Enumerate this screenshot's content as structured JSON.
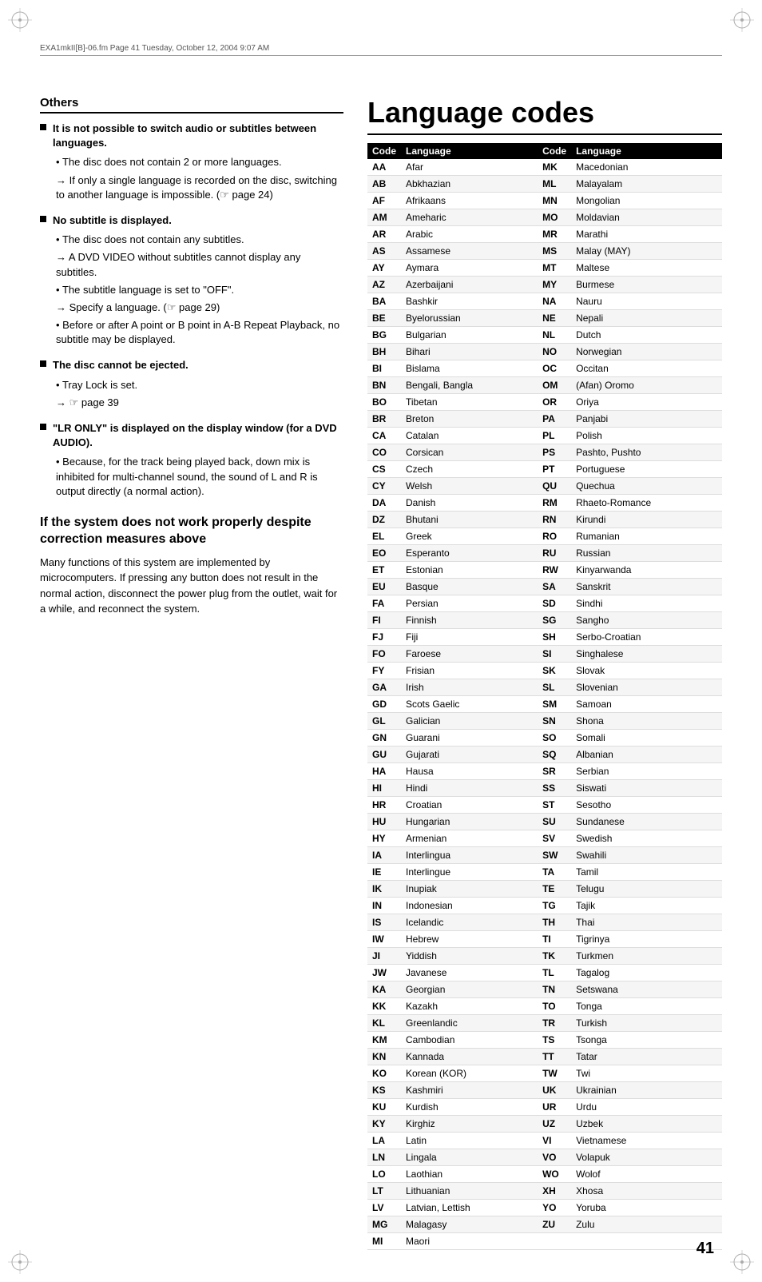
{
  "header": {
    "text": "EXA1mkII[B]-06.fm  Page 41  Tuesday, October 12, 2004  9:07 AM"
  },
  "page_title": "Language codes",
  "left": {
    "section_heading": "Others",
    "blocks": [
      {
        "id": "block1",
        "heading": "It is not possible to switch audio or subtitles between languages.",
        "sub_items": [
          {
            "type": "bullet",
            "text": "The disc does not contain 2 or more languages."
          },
          {
            "type": "arrow",
            "text": "If only a single language is recorded on the disc, switching to another language is impossible. (☞ page 24)"
          }
        ]
      },
      {
        "id": "block2",
        "heading": "No subtitle is displayed.",
        "sub_items": [
          {
            "type": "bullet",
            "text": "The disc does not contain any subtitles."
          },
          {
            "type": "arrow",
            "text": "A DVD VIDEO without subtitles cannot display any subtitles."
          },
          {
            "type": "bullet",
            "text": "The subtitle language is set to \"OFF\"."
          },
          {
            "type": "arrow",
            "text": "Specify a language. (☞ page 29)"
          },
          {
            "type": "bullet",
            "text": "Before or after A point or B point in A-B Repeat Playback, no subtitle may be displayed."
          }
        ]
      },
      {
        "id": "block3",
        "heading": "The disc cannot be ejected.",
        "sub_items": [
          {
            "type": "bullet",
            "text": "Tray Lock is set."
          },
          {
            "type": "arrow",
            "text": "☞ page 39"
          }
        ]
      },
      {
        "id": "block4",
        "heading": "\"LR ONLY\" is displayed on the display window (for a DVD AUDIO).",
        "sub_items": [
          {
            "type": "bullet",
            "text": "Because, for the track being played back, down mix is inhibited for multi-channel sound, the sound of L and R is output directly (a normal action)."
          }
        ]
      }
    ],
    "system_section": {
      "title": "If the system does not work properly despite correction measures above",
      "body": "Many functions of this system are implemented by microcomputers. If pressing any button does not result in the normal action, disconnect the power plug from the outlet, wait for a while, and reconnect the system."
    }
  },
  "table": {
    "headers": [
      "Code",
      "Language",
      "Code",
      "Language"
    ],
    "rows": [
      [
        "AA",
        "Afar",
        "MK",
        "Macedonian"
      ],
      [
        "AB",
        "Abkhazian",
        "ML",
        "Malayalam"
      ],
      [
        "AF",
        "Afrikaans",
        "MN",
        "Mongolian"
      ],
      [
        "AM",
        "Ameharic",
        "MO",
        "Moldavian"
      ],
      [
        "AR",
        "Arabic",
        "MR",
        "Marathi"
      ],
      [
        "AS",
        "Assamese",
        "MS",
        "Malay (MAY)"
      ],
      [
        "AY",
        "Aymara",
        "MT",
        "Maltese"
      ],
      [
        "AZ",
        "Azerbaijani",
        "MY",
        "Burmese"
      ],
      [
        "BA",
        "Bashkir",
        "NA",
        "Nauru"
      ],
      [
        "BE",
        "Byelorussian",
        "NE",
        "Nepali"
      ],
      [
        "BG",
        "Bulgarian",
        "NL",
        "Dutch"
      ],
      [
        "BH",
        "Bihari",
        "NO",
        "Norwegian"
      ],
      [
        "BI",
        "Bislama",
        "OC",
        "Occitan"
      ],
      [
        "BN",
        "Bengali, Bangla",
        "OM",
        "(Afan) Oromo"
      ],
      [
        "BO",
        "Tibetan",
        "OR",
        "Oriya"
      ],
      [
        "BR",
        "Breton",
        "PA",
        "Panjabi"
      ],
      [
        "CA",
        "Catalan",
        "PL",
        "Polish"
      ],
      [
        "CO",
        "Corsican",
        "PS",
        "Pashto, Pushto"
      ],
      [
        "CS",
        "Czech",
        "PT",
        "Portuguese"
      ],
      [
        "CY",
        "Welsh",
        "QU",
        "Quechua"
      ],
      [
        "DA",
        "Danish",
        "RM",
        "Rhaeto-Romance"
      ],
      [
        "DZ",
        "Bhutani",
        "RN",
        "Kirundi"
      ],
      [
        "EL",
        "Greek",
        "RO",
        "Rumanian"
      ],
      [
        "EO",
        "Esperanto",
        "RU",
        "Russian"
      ],
      [
        "ET",
        "Estonian",
        "RW",
        "Kinyarwanda"
      ],
      [
        "EU",
        "Basque",
        "SA",
        "Sanskrit"
      ],
      [
        "FA",
        "Persian",
        "SD",
        "Sindhi"
      ],
      [
        "FI",
        "Finnish",
        "SG",
        "Sangho"
      ],
      [
        "FJ",
        "Fiji",
        "SH",
        "Serbo-Croatian"
      ],
      [
        "FO",
        "Faroese",
        "SI",
        "Singhalese"
      ],
      [
        "FY",
        "Frisian",
        "SK",
        "Slovak"
      ],
      [
        "GA",
        "Irish",
        "SL",
        "Slovenian"
      ],
      [
        "GD",
        "Scots Gaelic",
        "SM",
        "Samoan"
      ],
      [
        "GL",
        "Galician",
        "SN",
        "Shona"
      ],
      [
        "GN",
        "Guarani",
        "SO",
        "Somali"
      ],
      [
        "GU",
        "Gujarati",
        "SQ",
        "Albanian"
      ],
      [
        "HA",
        "Hausa",
        "SR",
        "Serbian"
      ],
      [
        "HI",
        "Hindi",
        "SS",
        "Siswati"
      ],
      [
        "HR",
        "Croatian",
        "ST",
        "Sesotho"
      ],
      [
        "HU",
        "Hungarian",
        "SU",
        "Sundanese"
      ],
      [
        "HY",
        "Armenian",
        "SV",
        "Swedish"
      ],
      [
        "IA",
        "Interlingua",
        "SW",
        "Swahili"
      ],
      [
        "IE",
        "Interlingue",
        "TA",
        "Tamil"
      ],
      [
        "IK",
        "Inupiak",
        "TE",
        "Telugu"
      ],
      [
        "IN",
        "Indonesian",
        "TG",
        "Tajik"
      ],
      [
        "IS",
        "Icelandic",
        "TH",
        "Thai"
      ],
      [
        "IW",
        "Hebrew",
        "TI",
        "Tigrinya"
      ],
      [
        "JI",
        "Yiddish",
        "TK",
        "Turkmen"
      ],
      [
        "JW",
        "Javanese",
        "TL",
        "Tagalog"
      ],
      [
        "KA",
        "Georgian",
        "TN",
        "Setswana"
      ],
      [
        "KK",
        "Kazakh",
        "TO",
        "Tonga"
      ],
      [
        "KL",
        "Greenlandic",
        "TR",
        "Turkish"
      ],
      [
        "KM",
        "Cambodian",
        "TS",
        "Tsonga"
      ],
      [
        "KN",
        "Kannada",
        "TT",
        "Tatar"
      ],
      [
        "KO",
        "Korean (KOR)",
        "TW",
        "Twi"
      ],
      [
        "KS",
        "Kashmiri",
        "UK",
        "Ukrainian"
      ],
      [
        "KU",
        "Kurdish",
        "UR",
        "Urdu"
      ],
      [
        "KY",
        "Kirghiz",
        "UZ",
        "Uzbek"
      ],
      [
        "LA",
        "Latin",
        "VI",
        "Vietnamese"
      ],
      [
        "LN",
        "Lingala",
        "VO",
        "Volapuk"
      ],
      [
        "LO",
        "Laothian",
        "WO",
        "Wolof"
      ],
      [
        "LT",
        "Lithuanian",
        "XH",
        "Xhosa"
      ],
      [
        "LV",
        "Latvian, Lettish",
        "YO",
        "Yoruba"
      ],
      [
        "MG",
        "Malagasy",
        "ZU",
        "Zulu"
      ],
      [
        "MI",
        "Maori",
        "",
        ""
      ]
    ]
  },
  "page_number": "41"
}
